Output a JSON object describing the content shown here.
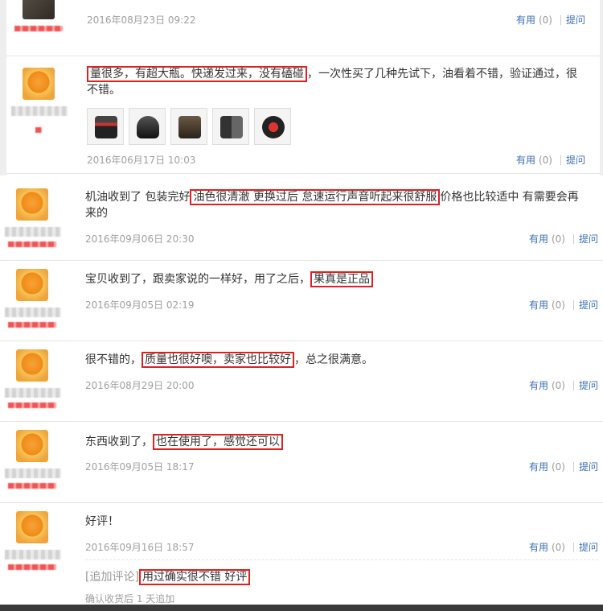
{
  "top_reviews": [
    {
      "content_pre": "",
      "highlight": "",
      "content_post": "",
      "date": "2016年08月23日 09:22",
      "useful_label": "有用",
      "useful_count": "(0)",
      "ask_label": "提问"
    },
    {
      "content_pre": "",
      "highlight": "量很多，有超大瓶。快递发过来，没有磕碰",
      "content_post": "，一次性买了几种先试下，油看着不错，验证通过，很不错。",
      "date": "2016年06月17日 10:03",
      "useful_label": "有用",
      "useful_count": "(0)",
      "ask_label": "提问",
      "photos": [
        "product-photo-1",
        "product-photo-2",
        "product-photo-3",
        "product-photo-4",
        "product-photo-5"
      ]
    }
  ],
  "reviews": [
    {
      "content_pre": "机油收到了 包装完好",
      "highlight": "油色很清澈 更换过后 怠速运行声音听起来很舒服",
      "content_post": "价格也比较适中 有需要会再来的",
      "date": "2016年09月06日 20:30",
      "useful_label": "有用",
      "useful_count": "(0)",
      "ask_label": "提问"
    },
    {
      "content_pre": "宝贝收到了，跟卖家说的一样好，用了之后，",
      "highlight": "果真是正品",
      "content_post": "",
      "date": "2016年09月05日 02:19",
      "useful_label": "有用",
      "useful_count": "(0)",
      "ask_label": "提问"
    },
    {
      "content_pre": "很不错的，",
      "highlight": "质量也很好噢，卖家也比较好",
      "content_post": "，总之很满意。",
      "date": "2016年08月29日 20:00",
      "useful_label": "有用",
      "useful_count": "(0)",
      "ask_label": "提问"
    },
    {
      "content_pre": "东西收到了，",
      "highlight": "也在使用了，感觉还可以",
      "content_post": "",
      "date": "2016年09月05日 18:17",
      "useful_label": "有用",
      "useful_count": "(0)",
      "ask_label": "提问"
    },
    {
      "content_pre": "好评！",
      "highlight": "",
      "content_post": "",
      "date": "2016年09月16日 18:57",
      "useful_label": "有用",
      "useful_count": "(0)",
      "ask_label": "提问",
      "append_label": "[追加评论]",
      "append_highlight": "用过确实很不错 好评",
      "append_time": "确认收货后 1 天追加"
    }
  ],
  "colors": {
    "link": "#3b6fb6",
    "highlight_border": "#e02020",
    "meta": "#a0a0a0"
  }
}
